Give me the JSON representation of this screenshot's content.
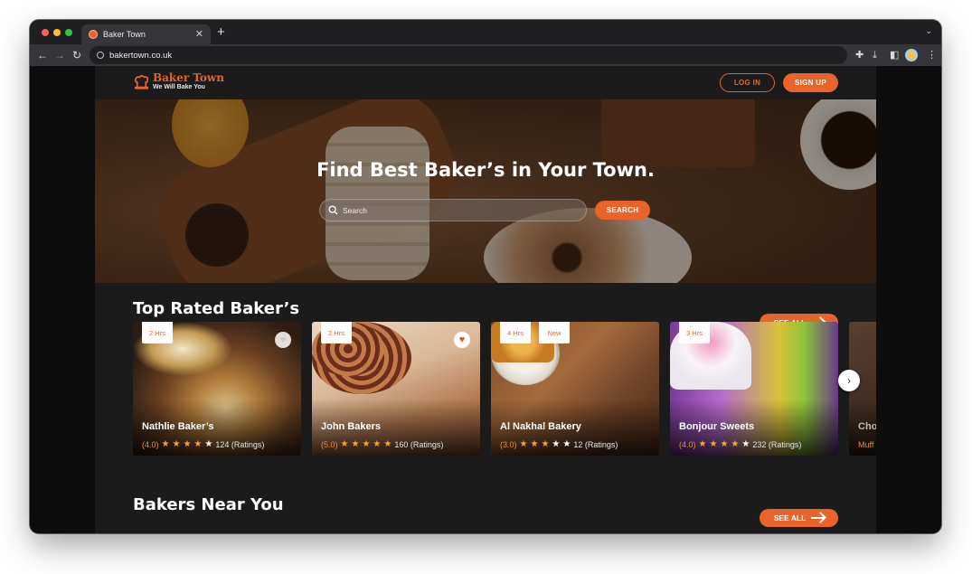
{
  "browser": {
    "tab_title": "Baker Town",
    "url": "bakertown.co.uk"
  },
  "site": {
    "brand": "Baker Town",
    "tagline": "We Will Bake You",
    "login_label": "LOG IN",
    "signup_label": "SIGN UP",
    "accent_color": "#e8642a"
  },
  "hero": {
    "title": "Find Best Baker’s in Your Town.",
    "search_placeholder": "Search",
    "search_button": "SEARCH"
  },
  "top_rated": {
    "title": "Top Rated Baker’s",
    "see_all": "SEE ALL",
    "cards": [
      {
        "badges": [
          "2 Hrs"
        ],
        "name": "Nathlie Baker’s",
        "score": "(4.0)",
        "stars": 4,
        "ratings": "124 (Ratings)",
        "favorite": false
      },
      {
        "badges": [
          "2 Hrs"
        ],
        "name": "John Bakers",
        "score": "(5.0)",
        "stars": 5,
        "ratings": "160 (Ratings)",
        "favorite": true
      },
      {
        "badges": [
          "4 Hrs",
          "New"
        ],
        "name": "Al Nakhal Bakery",
        "score": "(3.0)",
        "stars": 3,
        "ratings": "12 (Ratings)",
        "favorite": false
      },
      {
        "badges": [
          "3 Hrs"
        ],
        "name": "Bonjour Sweets",
        "score": "(4.0)",
        "stars": 4,
        "ratings": "232 (Ratings)",
        "favorite": false
      },
      {
        "badges": [],
        "name": "Cho",
        "score": "Muff",
        "stars": 0,
        "ratings": "",
        "favorite": false
      }
    ]
  },
  "near_you": {
    "title": "Bakers Near You",
    "see_all": "SEE ALL"
  }
}
